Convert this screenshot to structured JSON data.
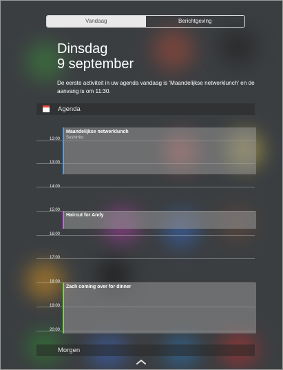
{
  "segmented_control": {
    "today_label": "Vandaag",
    "notifications_label": "Berichtgeving"
  },
  "today": {
    "weekday": "Dinsdag",
    "date": "9 september",
    "summary": "De eerste activiteit in uw agenda vandaag is 'Maandelijkse netwerklunch' en de aanvang is om 11:30."
  },
  "agenda": {
    "title": "Agenda",
    "hours": [
      "12:00",
      "13:00",
      "14:00",
      "15:00",
      "16:00",
      "17:00",
      "18:00",
      "19:00",
      "20:00"
    ],
    "events": [
      {
        "title": "Maandelijkse netwerklunch",
        "subtitle": "Sushirrito",
        "color": "#5aa0d8"
      },
      {
        "title": "Haircut for Andy",
        "subtitle": "",
        "color": "#c36bd8"
      },
      {
        "title": "Zach coming over for dinner",
        "subtitle": "",
        "color": "#7bd152"
      }
    ]
  },
  "tomorrow": {
    "title": "Morgen"
  },
  "icons": [
    "calendar-icon",
    "chevron-up-icon"
  ]
}
